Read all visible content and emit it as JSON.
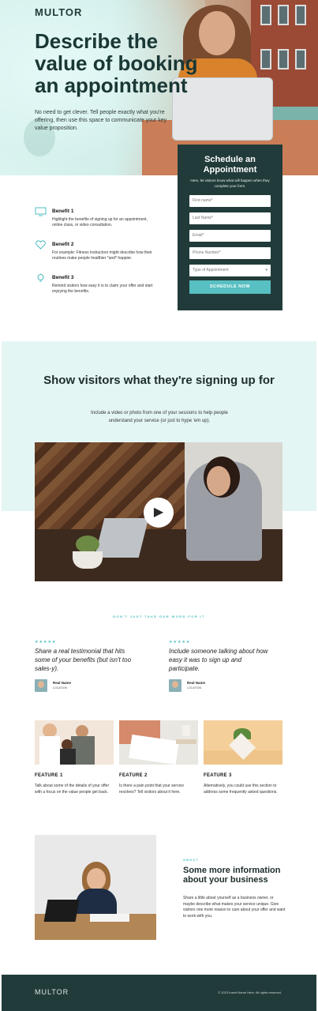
{
  "brand": {
    "logo": "MULTOR"
  },
  "hero": {
    "title": "Describe the value of booking an appointment",
    "subtitle": "No need to get clever. Tell people exactly what you're offering, then use this space to communicate your key value proposition."
  },
  "form": {
    "title": "Schedule an Appointment",
    "description": "Here, let visitors know what will happen when they complete your form.",
    "fields": {
      "first_name": "First name*",
      "last_name": "Last Name*",
      "email": "Email*",
      "phone": "Phone Number*",
      "type": "Type of Appointment"
    },
    "submit_label": "SCHEDULE NOW"
  },
  "benefits": [
    {
      "icon": "monitor-icon",
      "title": "Benefit 1",
      "text": "Highlight the benefits of signing up for an appointment, online class, or video consultation."
    },
    {
      "icon": "heart-icon",
      "title": "Benefit 2",
      "text": "For example: Fitness instructors might describe how their routines make people healthier *and* happier."
    },
    {
      "icon": "lightbulb-icon",
      "title": "Benefit 3",
      "text": "Remind visitors how easy it is to claim your offer and start enjoying the benefits."
    }
  ],
  "show": {
    "title": "Show visitors what they're signing up for",
    "subtitle": "Include a video or photo from one of your sessions to help people understand your service (or just to hype 'em up)."
  },
  "testimonials": {
    "kicker": "DON'T JUST TAKE OUR WORD FOR IT",
    "items": [
      {
        "stars": "★★★★★",
        "quote": "Share a real testimonial that hits some of your benefits (but isn't too sales-y).",
        "name": "Real Name",
        "location": "Location"
      },
      {
        "stars": "★★★★★",
        "quote": "Include someone talking about how easy it was to sign up and participate.",
        "name": "Real Name",
        "location": "Location"
      }
    ]
  },
  "features": [
    {
      "title": "FEATURE 1",
      "text": "Talk about some of the details of your offer with a focus on the value people get back."
    },
    {
      "title": "FEATURE 2",
      "text": "Is there a pain point that your service resolves? Tell visitors about it here."
    },
    {
      "title": "FEATURE 3",
      "text": "Alternatively, you could use this section to address some frequently asked questions."
    }
  ],
  "about": {
    "kicker": "ABOUT",
    "title": "Some more information about your business",
    "text": "Share a little about yourself as a business owner, or maybe describe what makes your service unique. Give visitors one more reason to care about your offer and want to work with you."
  },
  "footer": {
    "logo": "MULTOR",
    "copyright": "© 2023 Insert Name Here. All rights reserved."
  },
  "colors": {
    "accent": "#4dbdc1",
    "dark": "#213b3a",
    "light_band": "#e4f6f4"
  }
}
